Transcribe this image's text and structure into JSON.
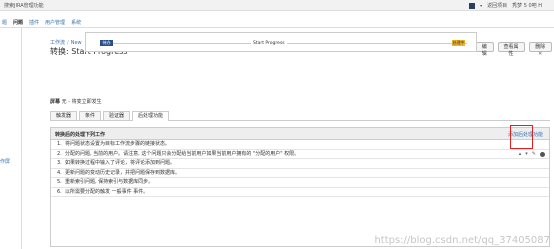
{
  "topbar": {
    "search_label": "搜索JIRA管理功能",
    "admin": "返回项目",
    "user": "秀梦 5 0吧 H"
  },
  "nav": [
    "题",
    "问题",
    "插件",
    "用户管理",
    "系统"
  ],
  "leftpanel": {
    "item": "作屏"
  },
  "breadcrumb": {
    "workflow": "工作流",
    "sep": "/",
    "current": "New"
  },
  "title": "转换: Start Progress",
  "actions": [
    "编辑",
    "查看属性",
    "删除"
  ],
  "diagram": {
    "from": "待办",
    "transition": "Start Progress",
    "to": "处理中"
  },
  "screen": {
    "label": "屏幕",
    "value": "无 - 将变立即发生"
  },
  "tabs": [
    "触发器",
    "条件",
    "验证器",
    "后处理功能"
  ],
  "functions": {
    "heading": "转换后的处理下列工作",
    "add_label": "添加后处理功能",
    "rows": [
      "将问题状态设置为目标工作流步骤的链接状态。",
      "分配的问题, 当前的用户。请注意, 这个问题只会分配给当前用户如果当前用户拥有的 \"分配的用户\" 权限。",
      "如果转换过程中输入了评论，将评论添加到问题。",
      "更新问题的变动历史记录，并把问题保存到数据库。",
      "重新索引问题, 保持索引与数据库同步。",
      "以所需要分配的触发 一般事件 事件。"
    ]
  },
  "watermark": "https://blog.csdn.net/qq_37405087"
}
